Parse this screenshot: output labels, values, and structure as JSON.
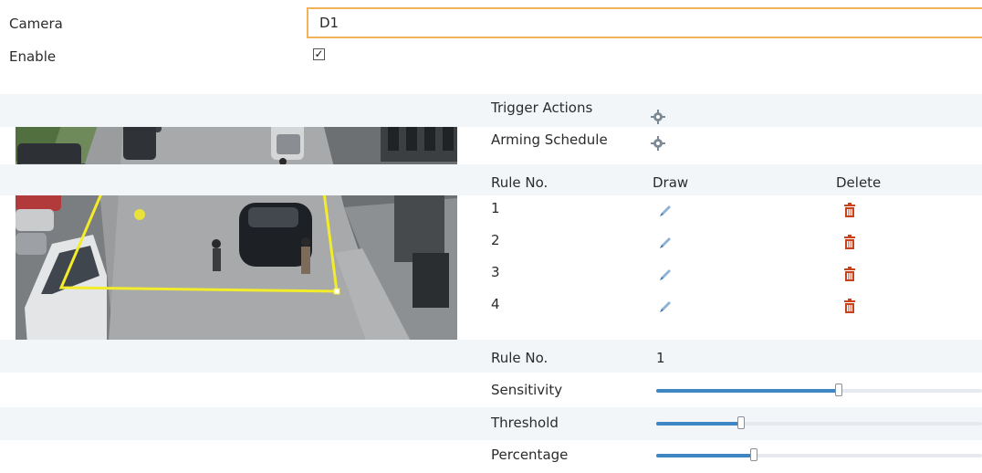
{
  "form": {
    "camera_label": "Camera",
    "camera_value": "D1",
    "enable_label": "Enable",
    "enable_checked": true
  },
  "actions": {
    "trigger_label": "Trigger Actions",
    "trigger_icon": "gear-icon",
    "schedule_label": "Arming Schedule",
    "schedule_icon": "gear-icon"
  },
  "rules_table": {
    "headers": [
      "Rule No.",
      "Draw",
      "Delete"
    ],
    "rows": [
      {
        "no": "1",
        "draw_icon": "pencil-icon",
        "delete_icon": "trash-icon"
      },
      {
        "no": "2",
        "draw_icon": "pencil-icon",
        "delete_icon": "trash-icon"
      },
      {
        "no": "3",
        "draw_icon": "pencil-icon",
        "delete_icon": "trash-icon"
      },
      {
        "no": "4",
        "draw_icon": "pencil-icon",
        "delete_icon": "trash-icon"
      }
    ]
  },
  "settings": {
    "rule_no_label": "Rule No.",
    "rule_no_value": "1",
    "sliders": [
      {
        "label": "Sensitivity",
        "fraction": 0.56
      },
      {
        "label": "Threshold",
        "fraction": 0.26
      },
      {
        "label": "Percentage",
        "fraction": 0.3
      }
    ]
  },
  "colors": {
    "accent": "#3f86c4",
    "input_border": "#f0b35a",
    "roi_outline": "#f2ec2b",
    "delete_icon": "#c8421b"
  }
}
